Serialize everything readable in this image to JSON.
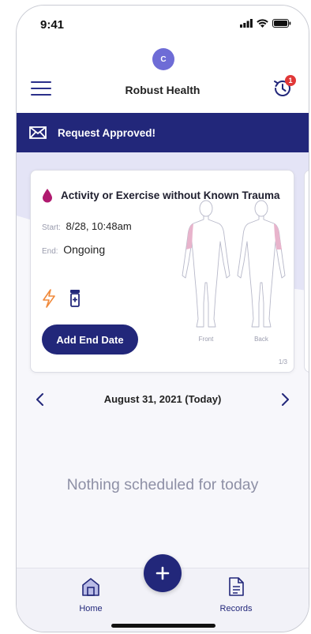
{
  "status_bar": {
    "time": "9:41"
  },
  "header": {
    "avatar_initial": "C",
    "title": "Robust Health",
    "notification_count": "1"
  },
  "banner": {
    "text": "Request Approved!"
  },
  "card": {
    "title": "Activity or Exercise without Known Trauma",
    "start_label": "Start:",
    "start_value": "8/28, 10:48am",
    "end_label": "End:",
    "end_value": "Ongoing",
    "add_end_date_label": "Add End Date",
    "front_label": "Front",
    "back_label": "Back",
    "pager": "1/3"
  },
  "date_nav": {
    "label": "August 31, 2021 (Today)"
  },
  "empty_state": {
    "message": "Nothing scheduled for today"
  },
  "bottom_nav": {
    "home_label": "Home",
    "records_label": "Records"
  },
  "colors": {
    "primary": "#22277a",
    "accent_avatar": "#6e6cd6",
    "badge": "#e03838",
    "drop": "#b01a6f",
    "lightning": "#f08a3c",
    "pain_highlight": "#e8b4cc"
  }
}
